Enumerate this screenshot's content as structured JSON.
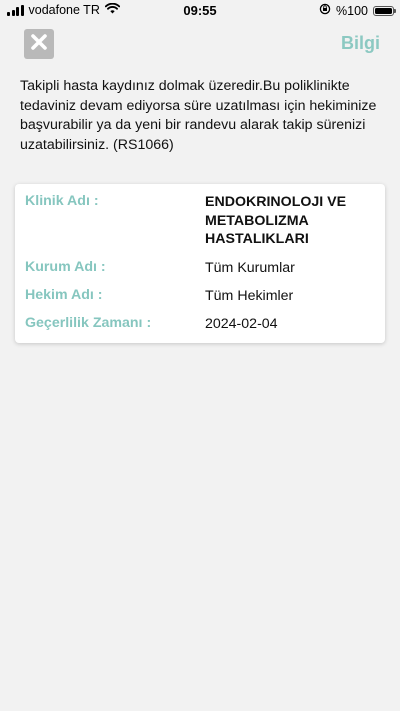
{
  "status_bar": {
    "carrier": "vodafone TR",
    "time": "09:55",
    "battery": "%100",
    "icons": [
      "signal-icon",
      "wifi-icon",
      "rotation-lock-icon",
      "battery-icon"
    ]
  },
  "header": {
    "close_icon": "close-icon",
    "title": "Bilgi"
  },
  "message": "Takipli hasta kaydınız dolmak üzeredir.Bu poliklinikte tedaviniz devam ediyorsa süre uzatılması için hekiminize başvurabilir ya da yeni bir randevu alarak takip sürenizi uzatabilirsiniz. (RS1066)",
  "details": {
    "clinic": {
      "label": "Klinik Adı :",
      "value": "ENDOKRINOLOJI VE METABOLIZMA HASTALIKLARI"
    },
    "institution": {
      "label": "Kurum Adı :",
      "value": "Tüm Kurumlar"
    },
    "doctor": {
      "label": "Hekim Adı :",
      "value": "Tüm Hekimler"
    },
    "validity": {
      "label": "Geçerlilik Zamanı :",
      "value": "2024-02-04"
    }
  },
  "colors": {
    "accent": "#86c6bf",
    "background": "#f2f2f2",
    "close_button": "#b9b9b9"
  }
}
